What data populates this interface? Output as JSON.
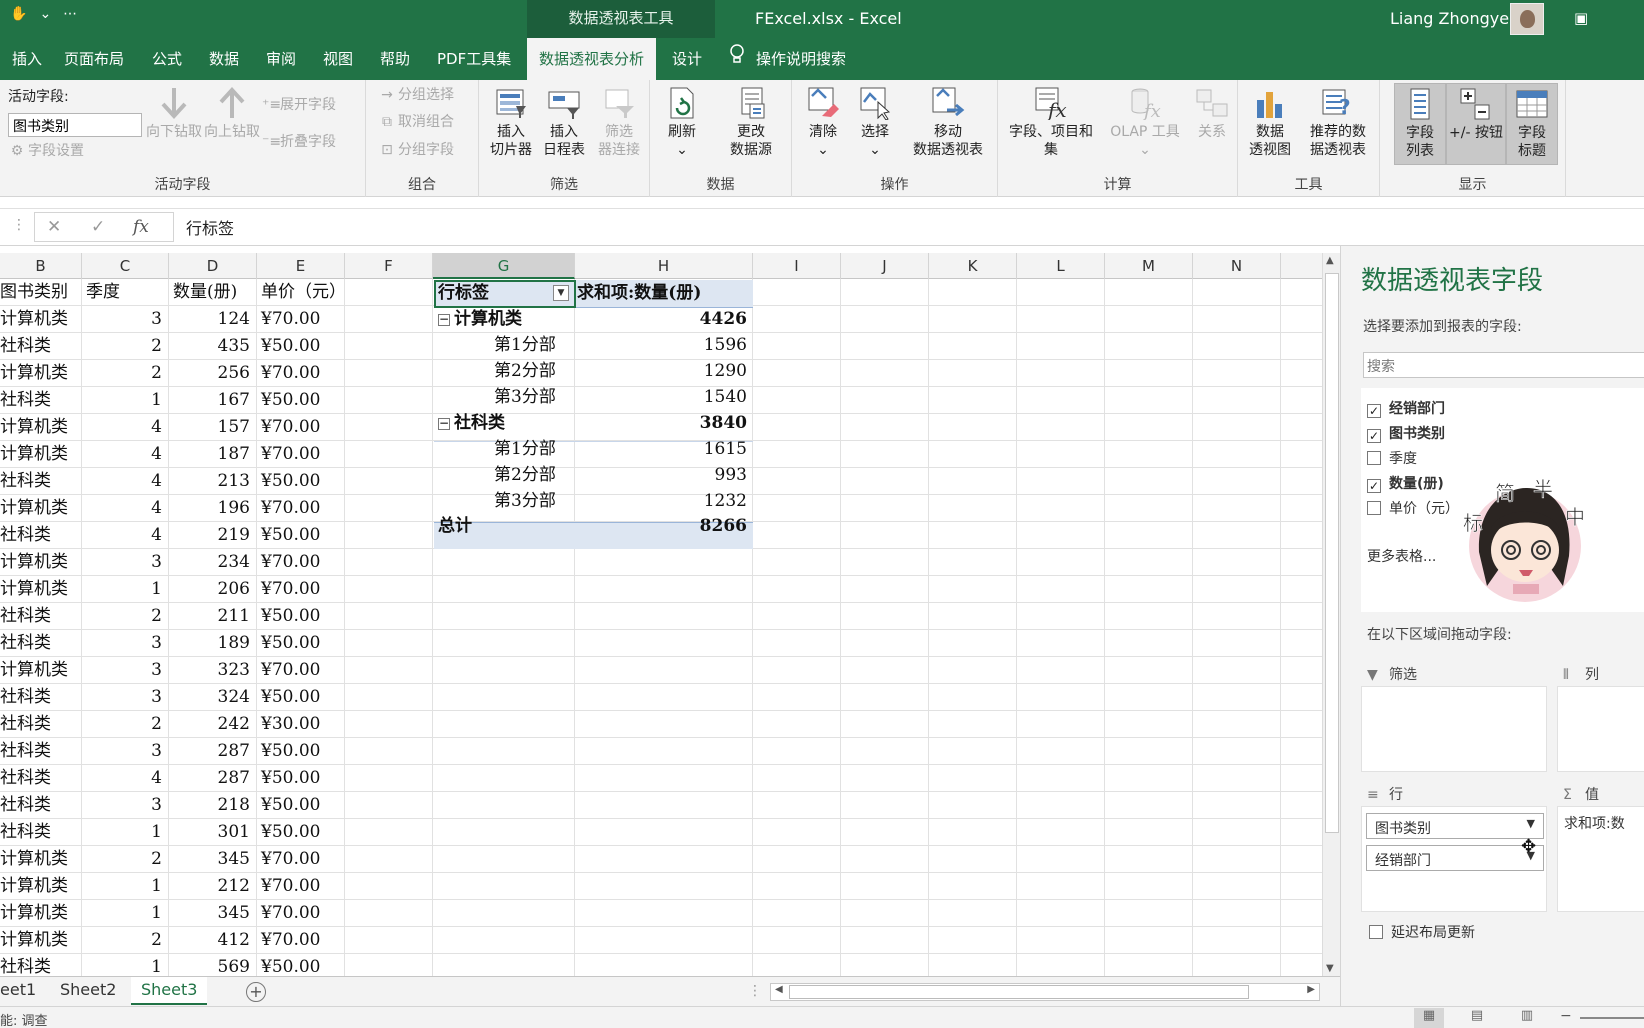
{
  "titlebar": {
    "context_tab_title": "数据透视表工具",
    "window_title": "FExcel.xlsx  -  Excel",
    "user_name": "Liang Zhongye",
    "qat": [
      "✋",
      "⌄",
      "⋯"
    ],
    "ribbon_display_icon": "▣"
  },
  "tabs": {
    "items": [
      "插入",
      "页面布局",
      "公式",
      "数据",
      "审阅",
      "视图",
      "帮助",
      "PDF工具集",
      "数据透视表分析",
      "设计"
    ],
    "tell_me": "操作说明搜索",
    "tell_me_icon": "lightbulb-icon",
    "colors": {
      "brand_green": "#217346",
      "context_green": "#1c5e3b"
    }
  },
  "ribbon": {
    "active_field": {
      "label": "活动字段:",
      "value": "图书类别",
      "settings": "字段设置",
      "drill_down": "向下钻取",
      "drill_up": "向上钻取",
      "expand": "展开字段",
      "collapse": "折叠字段",
      "group_label": "活动字段"
    },
    "group": {
      "selection": "分组选择",
      "ungroup": "取消组合",
      "field": "分组字段",
      "group_label": "组合"
    },
    "filter": {
      "slicer_1": "插入",
      "slicer_2": "切片器",
      "timeline_1": "插入",
      "timeline_2": "日程表",
      "conn_1": "筛选",
      "conn_2": "器连接",
      "group_label": "筛选"
    },
    "data": {
      "refresh": "刷新",
      "change_1": "更改",
      "change_2": "数据源",
      "group_label": "数据"
    },
    "actions": {
      "clear": "清除",
      "select": "选择",
      "move_1": "移动",
      "move_2": "数据透视表",
      "group_label": "操作"
    },
    "calc": {
      "fields_1": "字段、项目和",
      "fields_2": "集",
      "olap": "OLAP 工具",
      "relations": "关系",
      "group_label": "计算"
    },
    "tools": {
      "chart_1": "数据",
      "chart_2": "透视图",
      "recommend_1": "推荐的数",
      "recommend_2": "据透视表",
      "group_label": "工具"
    },
    "show": {
      "fieldlist_1": "字段",
      "fieldlist_2": "列表",
      "buttons": "+/- 按钮",
      "headers_1": "字段",
      "headers_2": "标题",
      "group_label": "显示"
    },
    "dropdown_glyph": "⌄"
  },
  "formula_bar": {
    "cancel": "✕",
    "enter": "✓",
    "fx": "fx",
    "value": "行标签"
  },
  "grid": {
    "columns": [
      "B",
      "C",
      "D",
      "E",
      "F",
      "G",
      "H",
      "I",
      "J",
      "K",
      "L",
      "M",
      "N"
    ],
    "header_row": [
      "图书类别",
      "季度",
      "数量(册)",
      "单价（元）"
    ],
    "rows": [
      [
        "计算机类",
        "3",
        "124",
        "¥70.00"
      ],
      [
        "社科类",
        "2",
        "435",
        "¥50.00"
      ],
      [
        "计算机类",
        "2",
        "256",
        "¥70.00"
      ],
      [
        "社科类",
        "1",
        "167",
        "¥50.00"
      ],
      [
        "计算机类",
        "4",
        "157",
        "¥70.00"
      ],
      [
        "计算机类",
        "4",
        "187",
        "¥70.00"
      ],
      [
        "社科类",
        "4",
        "213",
        "¥50.00"
      ],
      [
        "计算机类",
        "4",
        "196",
        "¥70.00"
      ],
      [
        "社科类",
        "4",
        "219",
        "¥50.00"
      ],
      [
        "计算机类",
        "3",
        "234",
        "¥70.00"
      ],
      [
        "计算机类",
        "1",
        "206",
        "¥70.00"
      ],
      [
        "社科类",
        "2",
        "211",
        "¥50.00"
      ],
      [
        "社科类",
        "3",
        "189",
        "¥50.00"
      ],
      [
        "计算机类",
        "3",
        "323",
        "¥70.00"
      ],
      [
        "社科类",
        "3",
        "324",
        "¥50.00"
      ],
      [
        "社科类",
        "2",
        "242",
        "¥30.00"
      ],
      [
        "社科类",
        "3",
        "287",
        "¥50.00"
      ],
      [
        "社科类",
        "4",
        "287",
        "¥50.00"
      ],
      [
        "社科类",
        "3",
        "218",
        "¥50.00"
      ],
      [
        "社科类",
        "1",
        "301",
        "¥50.00"
      ],
      [
        "计算机类",
        "2",
        "345",
        "¥70.00"
      ],
      [
        "计算机类",
        "1",
        "212",
        "¥70.00"
      ],
      [
        "计算机类",
        "1",
        "345",
        "¥70.00"
      ],
      [
        "计算机类",
        "2",
        "412",
        "¥70.00"
      ],
      [
        "社科类",
        "1",
        "569",
        "¥50.00"
      ]
    ]
  },
  "pivot": {
    "row_label": "行标签",
    "sum_label": "求和项:数量(册)",
    "collapse_glyph": "−",
    "groups": [
      {
        "name": "计算机类",
        "total": "4426",
        "items": [
          [
            "第1分部",
            "1596"
          ],
          [
            "第2分部",
            "1290"
          ],
          [
            "第3分部",
            "1540"
          ]
        ]
      },
      {
        "name": "社科类",
        "total": "3840",
        "items": [
          [
            "第1分部",
            "1615"
          ],
          [
            "第2分部",
            "993"
          ],
          [
            "第3分部",
            "1232"
          ]
        ]
      }
    ],
    "grand_label": "总计",
    "grand_total": "8266",
    "header_bg": "#dde6f2"
  },
  "sheets": {
    "tabs": [
      "eet1",
      "Sheet2",
      "Sheet3"
    ],
    "add": "+"
  },
  "status": {
    "text": "能: 调查",
    "views": [
      "▦",
      "▤",
      "▥"
    ]
  },
  "pane": {
    "title": "数据透视表字段",
    "subtitle": "选择要添加到报表的字段:",
    "search_placeholder": "搜索",
    "fields": [
      {
        "name": "经销部门",
        "checked": "✓"
      },
      {
        "name": "图书类别",
        "checked": "✓"
      },
      {
        "name": "季度",
        "checked": ""
      },
      {
        "name": "数量(册)",
        "checked": "✓"
      },
      {
        "name": "单价（元）",
        "checked": ""
      }
    ],
    "more_tables": "更多表格...",
    "drag_label": "在以下区域间拖动字段:",
    "zones": {
      "filter": "筛选",
      "columns": "列",
      "rows": "行",
      "values": "值"
    },
    "row_pills": [
      "图书类别",
      "经销部门"
    ],
    "value_pill": "求和项:数",
    "defer": "延迟布局更新",
    "sticker_text": [
      "标",
      "简",
      "半",
      "中"
    ]
  }
}
